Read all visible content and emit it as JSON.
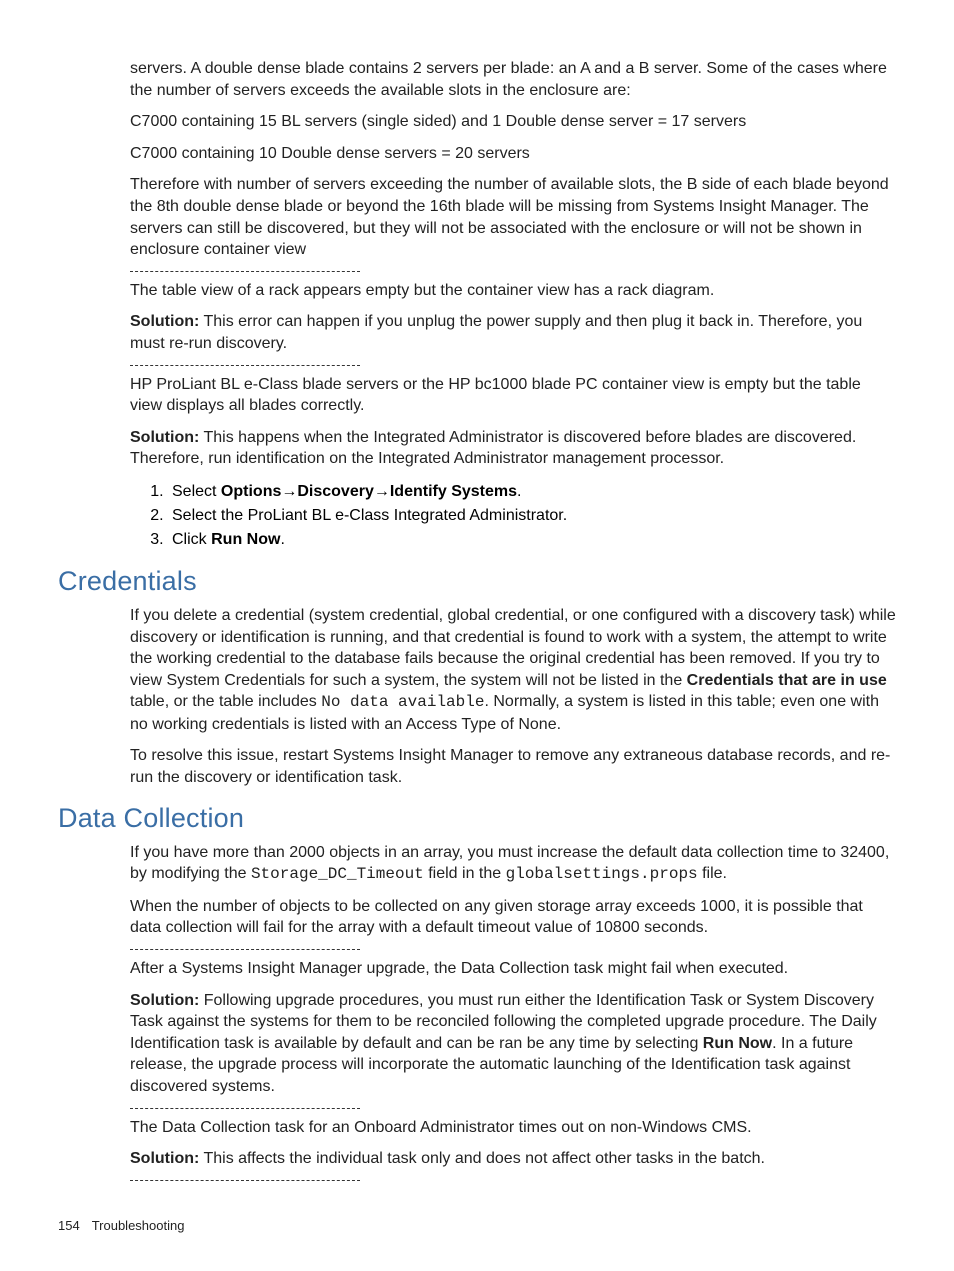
{
  "p1": "servers. A double dense blade contains 2 servers per blade: an A and a B server. Some of the cases where the number of servers exceeds the available slots in the enclosure are:",
  "p2": "C7000 containing 15 BL servers (single sided) and 1 Double dense server = 17 servers",
  "p3": "C7000 containing 10 Double dense servers = 20 servers",
  "p4": "Therefore with number of servers exceeding the number of available slots, the B side of each blade beyond the 8th double dense blade or beyond the 16th blade will be missing from Systems Insight Manager. The servers can still be discovered, but they will not be associated with the enclosure or will not be shown in enclosure container view",
  "p5": "The table view of a rack appears empty but the container view has a rack diagram.",
  "p6a": "Solution:",
  "p6b": " This error can happen if you unplug the power supply and then plug it back in. Therefore, you must re-run discovery.",
  "p7": "HP ProLiant BL e-Class blade servers or the HP bc1000 blade PC container view is empty but the table view displays all blades correctly.",
  "p8a": "Solution:",
  "p8b": " This happens when the Integrated Administrator is discovered before blades are discovered. Therefore, run identification on the Integrated Administrator management processor.",
  "step1a": "Select ",
  "step1b": "Options",
  "step1c": "→",
  "step1d": "Discovery",
  "step1e": "→",
  "step1f": "Identify Systems",
  "step1g": ".",
  "step2": "Select the ProLiant BL e-Class Integrated Administrator.",
  "step3a": "Click ",
  "step3b": "Run Now",
  "step3c": ".",
  "h_cred": "Credentials",
  "cred_p1a": "If you delete a credential (system credential, global credential, or one configured with a discovery task) while discovery or identification is running, and that credential is found to work with a system, the attempt to write the working credential to the database fails because the original credential has been removed. If you try to view System Credentials for such a system, the system will not be listed in the ",
  "cred_p1b": "Credentials that are in use",
  "cred_p1c": " table, or the table includes ",
  "cred_p1d": "No data available",
  "cred_p1e": ". Normally, a system is listed in this table; even one with no working credentials is listed with an Access Type of None.",
  "cred_p2": "To resolve this issue, restart Systems Insight Manager to remove any extraneous database records, and re-run the discovery or identification task.",
  "h_dc": "Data Collection",
  "dc_p1a": "If you have more than 2000 objects in an array, you must increase the default data collection time to 32400, by modifying the ",
  "dc_p1b": "Storage_DC_Timeout",
  "dc_p1c": " field in the ",
  "dc_p1d": "globalsettings.props",
  "dc_p1e": " file.",
  "dc_p2": "When the number of objects to be collected on any given storage array exceeds 1000, it is possible that data collection will fail for the array with a default timeout value of 10800 seconds.",
  "dc_p3": "After a Systems Insight Manager upgrade, the Data Collection task might fail when executed.",
  "dc_p4a": "Solution:",
  "dc_p4b": " Following upgrade procedures, you must run either the Identification Task or System Discovery Task against the systems for them to be reconciled following the completed upgrade procedure. The Daily Identification task is available by default and can be ran be any time by selecting ",
  "dc_p4c": "Run Now",
  "dc_p4d": ". In a future release, the upgrade process will incorporate the automatic launching of the Identification task against discovered systems.",
  "dc_p5": "The Data Collection task for an Onboard Administrator times out on non-Windows CMS.",
  "dc_p6a": "Solution:",
  "dc_p6b": " This affects the individual task only and does not affect other tasks in the batch.",
  "footer_page": "154",
  "footer_title": "Troubleshooting"
}
